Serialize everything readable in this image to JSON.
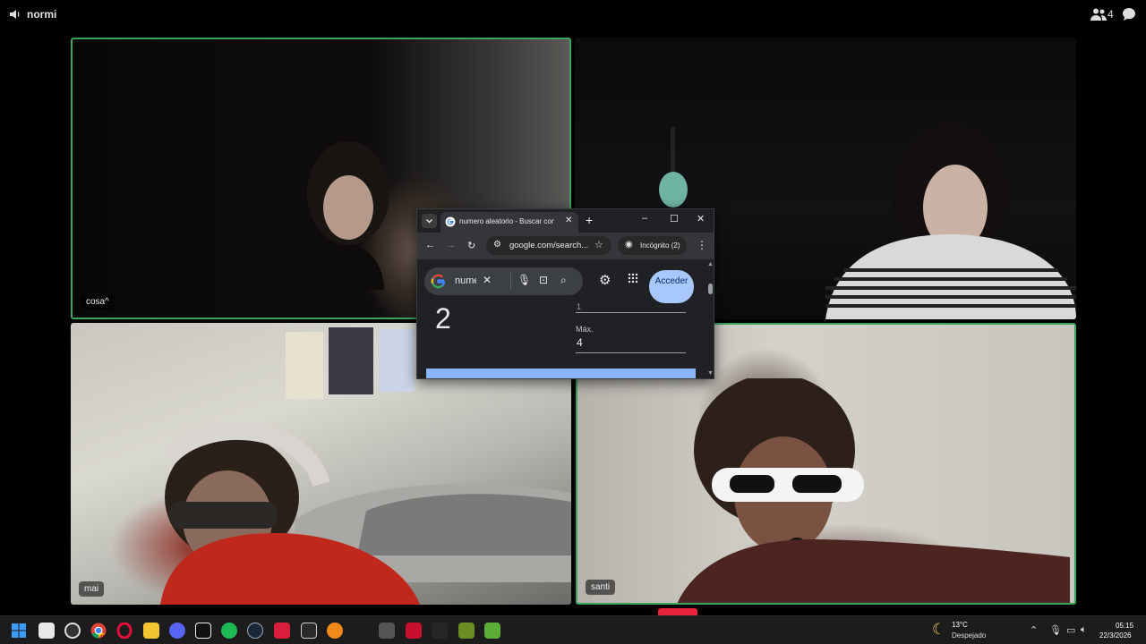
{
  "app": {
    "channel_name": "normi",
    "participant_count": "4"
  },
  "tiles": [
    {
      "name": "cosa^",
      "speaking": true
    },
    {
      "name": "",
      "speaking": false
    },
    {
      "name": "mai",
      "speaking": false
    },
    {
      "name": "santi",
      "speaking": true
    }
  ],
  "browser": {
    "tab_title": "numero aleatorio - Buscar con Google",
    "tab_close": "✕",
    "new_tab": "+",
    "window_controls": [
      "–",
      "☐",
      "✕"
    ],
    "url": "google.com/search...",
    "incognito_label": "Incógnito (2)",
    "search_query": "numero aleatorio",
    "sign_in_label": "Acceder",
    "result_number": "2",
    "min_value": "1",
    "max_label": "Máx.",
    "max_value": "4"
  },
  "taskbar": {
    "weather_temp": "13°C",
    "weather_desc": "Despejado",
    "time": "05:15",
    "date": "22/3/2026",
    "apps": [
      "windows-start",
      "task-view",
      "obs",
      "chrome",
      "opera-gx",
      "file-explorer",
      "discord",
      "capcut",
      "spotify",
      "steam",
      "roblox",
      "epic-games",
      "unknown-orange",
      "vm",
      "nvidia-app",
      "unknown-dark",
      "minecraft-launcher",
      "minecraft"
    ],
    "colors": {
      "taskbar_bg": "#1c1c1c",
      "speaking_border": "#3ba55c",
      "accent_blue": "#a8c7fa"
    }
  }
}
